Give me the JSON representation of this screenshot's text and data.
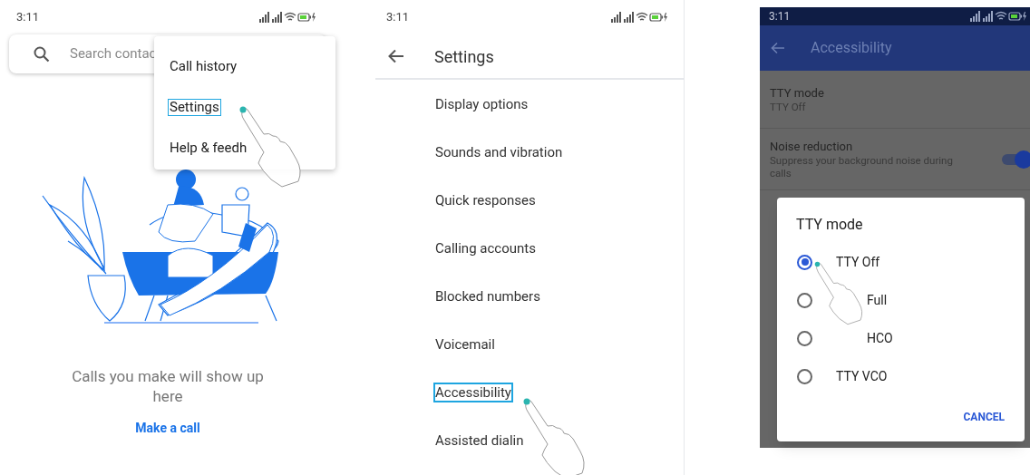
{
  "call_log_screen": {
    "status_time": "3:11",
    "search": {
      "placeholder": "Search contac"
    },
    "menu": [
      {
        "label": "Call history",
        "highlighted": false
      },
      {
        "label": "Settings",
        "highlighted": true
      },
      {
        "label": "Help & feedh",
        "highlighted": false
      }
    ],
    "empty_message": "Calls you make will show up here",
    "action": "Make a call"
  },
  "settings_screen": {
    "status_time": "3:11",
    "title": "Settings",
    "items": [
      {
        "label": "Display options",
        "highlighted": false
      },
      {
        "label": "Sounds and vibration",
        "highlighted": false
      },
      {
        "label": "Quick responses",
        "highlighted": false
      },
      {
        "label": "Calling accounts",
        "highlighted": false
      },
      {
        "label": "Blocked numbers",
        "highlighted": false
      },
      {
        "label": "Voicemail",
        "highlighted": false
      },
      {
        "label": "Accessibility",
        "highlighted": true
      },
      {
        "label": "Assisted dialin",
        "highlighted": false
      }
    ]
  },
  "accessibility_screen": {
    "status_time": "3:11",
    "title": "Accessibility",
    "rows": [
      {
        "kind": "value",
        "title": "TTY mode",
        "subtitle": "TTY Off"
      },
      {
        "kind": "switch",
        "title": "Noise reduction",
        "subtitle": "Suppress your background noise during calls",
        "on": true
      }
    ],
    "dialog": {
      "title": "TTY mode",
      "options": [
        {
          "label": "TTY Off",
          "selected": true
        },
        {
          "label": "Full",
          "selected": false
        },
        {
          "label": "HCO",
          "selected": false
        },
        {
          "label": "TTY VCO",
          "selected": false
        }
      ],
      "button": "CANCEL"
    }
  }
}
